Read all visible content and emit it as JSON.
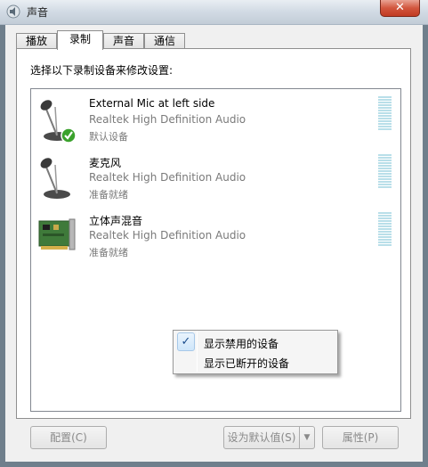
{
  "window": {
    "title": "声音",
    "close_glyph": "✕"
  },
  "tabs": [
    {
      "label": "播放",
      "active": false
    },
    {
      "label": "录制",
      "active": true
    },
    {
      "label": "声音",
      "active": false
    },
    {
      "label": "通信",
      "active": false
    }
  ],
  "instruction": "选择以下录制设备来修改设置:",
  "devices": [
    {
      "name": "External Mic at left side",
      "driver": "Realtek High Definition Audio",
      "status": "默认设备",
      "icon": "microphone-icon",
      "is_default": true
    },
    {
      "name": "麦克风",
      "driver": "Realtek High Definition Audio",
      "status": "准备就绪",
      "icon": "microphone-icon",
      "is_default": false
    },
    {
      "name": "立体声混音",
      "driver": "Realtek High Definition Audio",
      "status": "准备就绪",
      "icon": "sound-card-icon",
      "is_default": false
    }
  ],
  "context_menu": {
    "items": [
      {
        "label": "显示禁用的设备",
        "checked": true
      },
      {
        "label": "显示已断开的设备",
        "checked": false
      }
    ],
    "check_glyph": "✓"
  },
  "buttons": {
    "configure": "配置(C)",
    "set_default": "设为默认值(S)",
    "set_default_arrow": "▼",
    "properties": "属性(P)"
  },
  "colors": {
    "level_meter": "#b9dfe9",
    "default_check": "#3aa12c"
  }
}
